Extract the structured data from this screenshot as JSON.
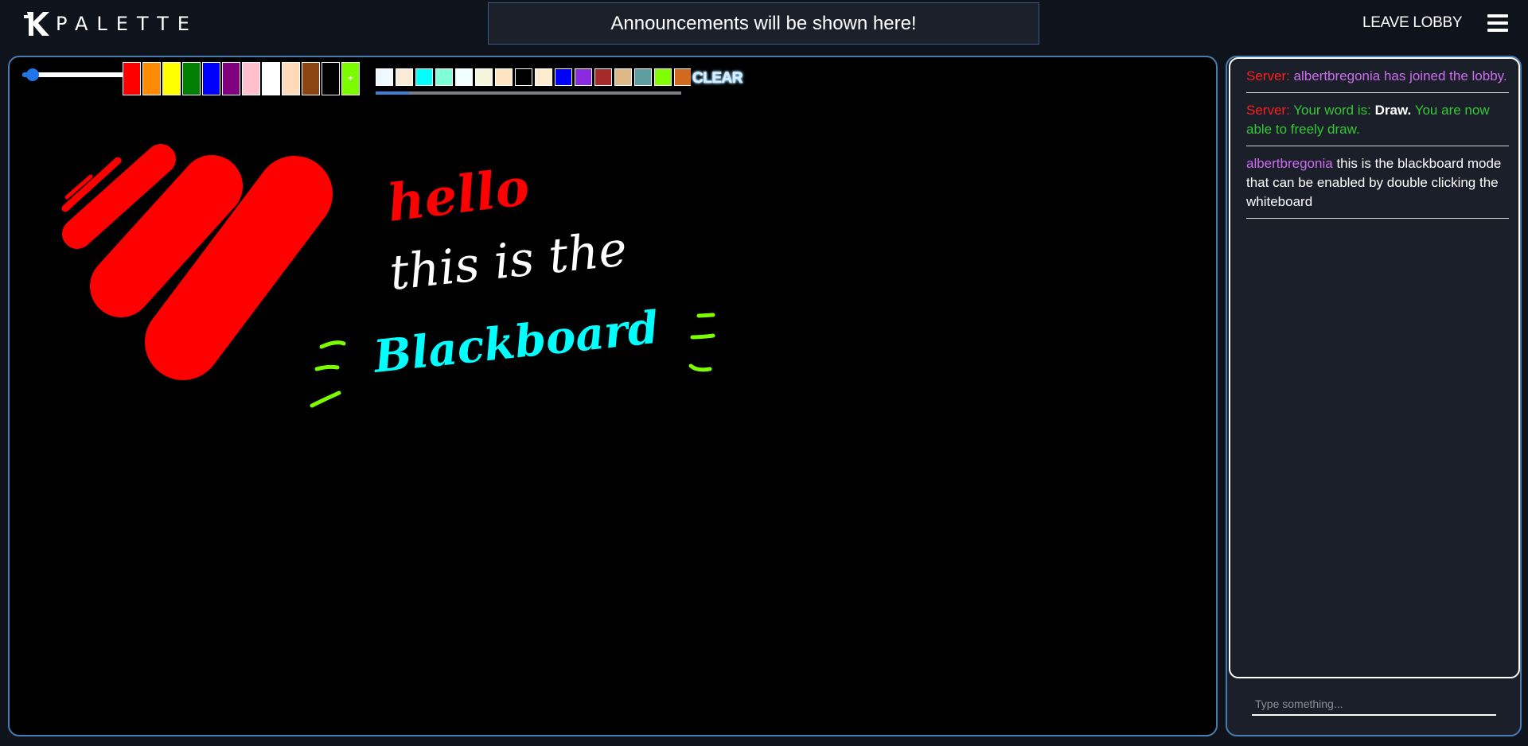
{
  "app": {
    "name": "PALETTE"
  },
  "header": {
    "announcement": "Announcements will be shown here!",
    "leave_label": "LEAVE LOBBY"
  },
  "toolbar": {
    "brush_size": 0.1,
    "palette": [
      "#ff0000",
      "#ff8c00",
      "#ffff00",
      "#008000",
      "#0000ff",
      "#800080",
      "#ffc0cb",
      "#ffffff",
      "#ffdab9",
      "#8b4513",
      "#000000",
      "#7cfc00"
    ],
    "add_label": "+",
    "recent_colors": [
      "#f0f8ff",
      "#faebd7",
      "#00ffff",
      "#7fffd4",
      "#f0ffff",
      "#f5f5dc",
      "#ffe4c4",
      "#000000",
      "#ffebcd",
      "#0000ff",
      "#8a2be2",
      "#a52a2a",
      "#deb887",
      "#5f9ea0",
      "#7fff00",
      "#d2691e"
    ],
    "clear_label": "CLEAR"
  },
  "drawing": {
    "text_hello": "hello",
    "text_line2": "this is the",
    "text_line3": "Blackboard"
  },
  "chat": {
    "messages": [
      {
        "sender": "Server:",
        "parts": [
          "albertbregonia has joined the lobby."
        ]
      },
      {
        "sender": "Server:",
        "parts": [
          "Your word is:",
          "Draw.",
          "You are now able to freely draw."
        ]
      },
      {
        "sender": "albertbregonia",
        "parts": [
          "this is the blackboard mode that can be enabled by double clicking the whiteboard"
        ]
      }
    ],
    "input_placeholder": "Type something..."
  },
  "colors": {
    "panel_border": "#4a7cb0",
    "server": "#ff1f1f",
    "user": "#cd6df0",
    "success": "#35c735"
  }
}
